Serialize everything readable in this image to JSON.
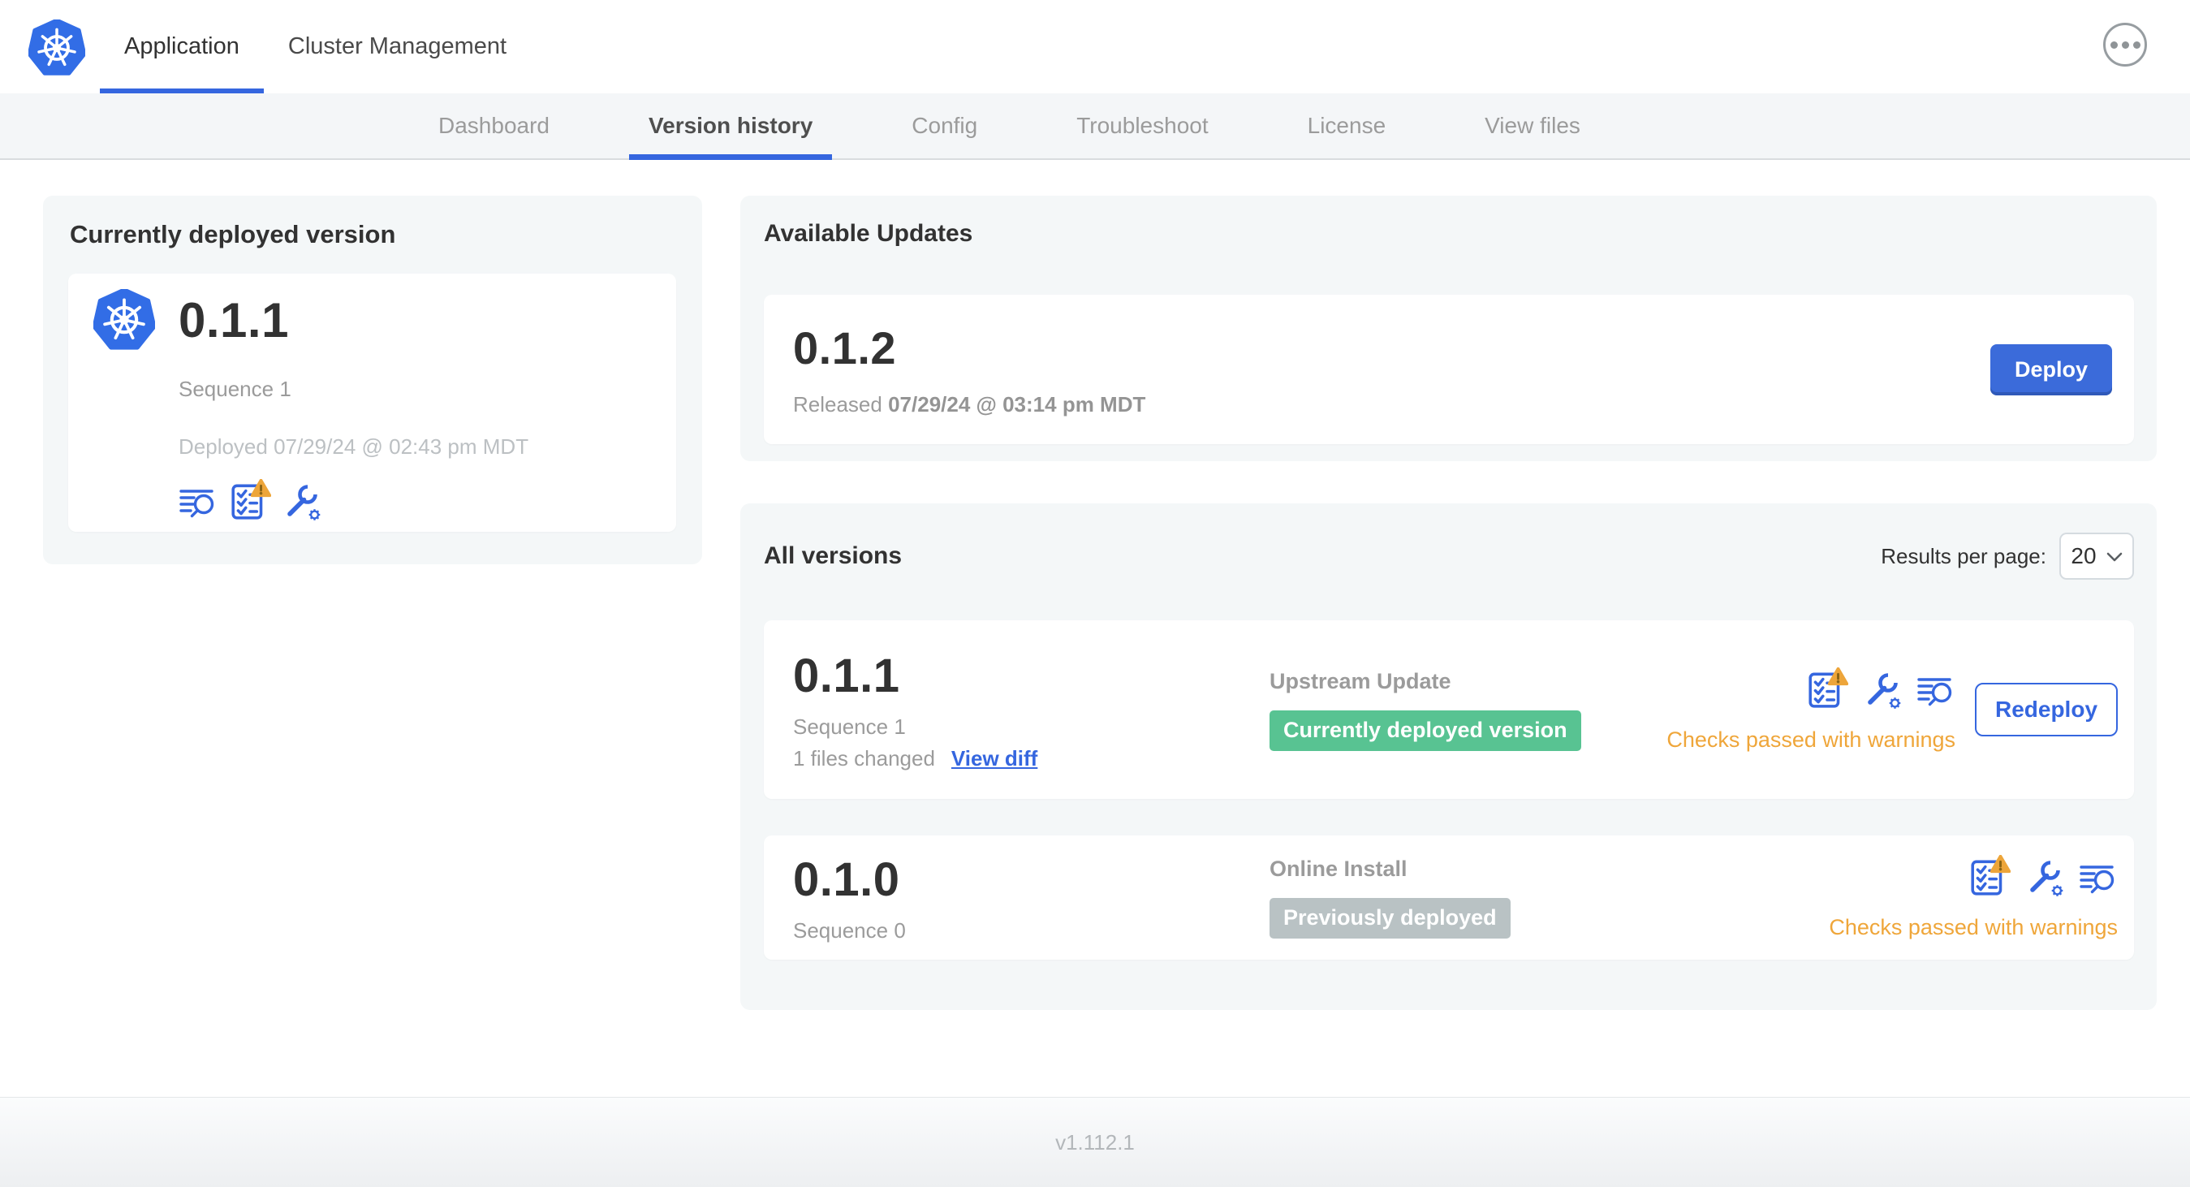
{
  "header": {
    "tabs": [
      {
        "label": "Application",
        "active": true
      },
      {
        "label": "Cluster Management",
        "active": false
      }
    ],
    "overflow_menu_icon": "ellipsis-icon"
  },
  "subnav": {
    "tabs": [
      {
        "label": "Dashboard",
        "active": false
      },
      {
        "label": "Version history",
        "active": true
      },
      {
        "label": "Config",
        "active": false
      },
      {
        "label": "Troubleshoot",
        "active": false
      },
      {
        "label": "License",
        "active": false
      },
      {
        "label": "View files",
        "active": false
      }
    ]
  },
  "current_version_card": {
    "title": "Currently deployed version",
    "version": "0.1.1",
    "sequence": "Sequence 1",
    "deployed": "Deployed 07/29/24 @ 02:43 pm MDT",
    "icons": [
      "view-logs-icon",
      "preflight-checks-warning-icon",
      "edit-config-icon"
    ]
  },
  "available_updates": {
    "title": "Available Updates",
    "update": {
      "version": "0.1.2",
      "released_prefix": "Released",
      "released_date": "07/29/24 @ 03:14 pm MDT",
      "deploy_label": "Deploy"
    }
  },
  "all_versions": {
    "title": "All versions",
    "results_per_page_label": "Results per page:",
    "results_per_page_value": "20",
    "rows": [
      {
        "version": "0.1.1",
        "sequence": "Sequence 1",
        "files_changed": "1 files changed",
        "view_diff_label": "View diff",
        "source": "Upstream Update",
        "badge_label": "Currently deployed version",
        "badge_color": "green",
        "icons": [
          "preflight-checks-warning-icon",
          "edit-config-icon",
          "view-logs-icon"
        ],
        "status": "Checks passed with warnings",
        "action_label": "Redeploy"
      },
      {
        "version": "0.1.0",
        "sequence": "Sequence 0",
        "source": "Online Install",
        "badge_label": "Previously deployed",
        "badge_color": "gray",
        "icons": [
          "preflight-checks-warning-icon",
          "edit-config-icon",
          "view-logs-icon"
        ],
        "status": "Checks passed with warnings"
      }
    ]
  },
  "footer": {
    "version": "v1.112.1"
  },
  "colors": {
    "accent_blue": "#3566DF",
    "kubernetes_blue": "#326DE6",
    "deployed_badge_green": "#58C392",
    "previous_badge_gray": "#B9C2C4",
    "warning_amber": "#EFA63A",
    "panel_background": "#F4F7F8",
    "subnav_background": "#F4F6F8"
  }
}
